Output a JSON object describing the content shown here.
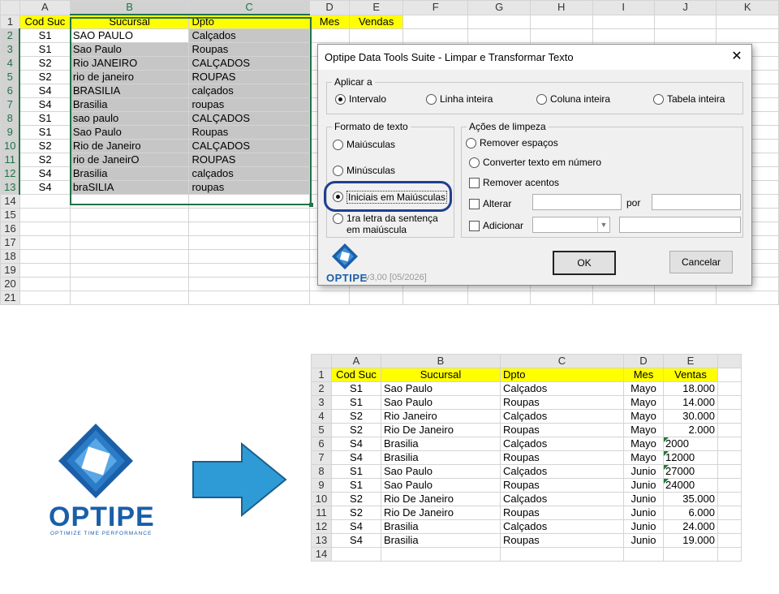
{
  "top_sheet": {
    "col_headers": [
      "A",
      "B",
      "C",
      "D",
      "E",
      "F",
      "G",
      "H",
      "I",
      "J",
      "K"
    ],
    "header_row": [
      "Cod Suc",
      "Sucursal",
      "Dpto",
      "Mes",
      "Vendas"
    ],
    "rows": [
      [
        "S1",
        "SAO PAULO",
        "Calçados"
      ],
      [
        "S1",
        "Sao Paulo",
        "Roupas"
      ],
      [
        "S2",
        "Rio JANEIRO",
        "CALÇADOS"
      ],
      [
        "S2",
        "rio de janeiro",
        "ROUPAS"
      ],
      [
        "S4",
        "BRASILIA",
        "calçados"
      ],
      [
        "S4",
        "Brasilia",
        "roupas"
      ],
      [
        "S1",
        "sao paulo",
        "CALÇADOS"
      ],
      [
        "S1",
        "Sao Paulo",
        "Roupas"
      ],
      [
        "S2",
        "Rio de Janeiro",
        "CALÇADOS"
      ],
      [
        "S2",
        "rio de JaneirO",
        "ROUPAS"
      ],
      [
        "S4",
        "Brasilia",
        "calçados"
      ],
      [
        "S4",
        "braSILIA",
        "roupas"
      ]
    ],
    "row_numbers": [
      "1",
      "2",
      "3",
      "4",
      "5",
      "6",
      "7",
      "8",
      "9",
      "10",
      "11",
      "12",
      "13",
      "14",
      "15",
      "16",
      "17",
      "18",
      "19",
      "20",
      "21"
    ]
  },
  "dialog": {
    "title": "Optipe Data Tools Suite - Limpar e Transformar Texto",
    "close_glyph": "✕",
    "scope_group": "Aplicar a",
    "scope_options": [
      "Intervalo",
      "Linha inteira",
      "Coluna inteira",
      "Tabela inteira"
    ],
    "format_group": "Formato de texto",
    "format_options": [
      "Maiúsculas",
      "Minúsculas",
      "Iniciais em Maiúsculas",
      "1ra letra da sentença em maiúscula"
    ],
    "clean_group": "Ações de limpeza",
    "clean_remove_spaces": "Remover espaços",
    "clean_convert_number": "Converter texto em número",
    "clean_remove_accents": "Remover acentos",
    "clean_replace": "Alterar",
    "clean_by": "por",
    "clean_add": "Adicionar",
    "brand": "OPTIPE",
    "version": "v3,00 [05/2026]",
    "ok_label": "OK",
    "cancel_label": "Cancelar"
  },
  "logo": {
    "brand": "OPTIPE",
    "tagline": "OPTIMIZE TIME PERFORMANCE"
  },
  "bottom_sheet": {
    "col_headers": [
      "A",
      "B",
      "C",
      "D",
      "E"
    ],
    "header_row": [
      "Cod Suc",
      "Sucursal",
      "Dpto",
      "Mes",
      "Ventas"
    ],
    "rows": [
      [
        "S1",
        "Sao Paulo",
        "Calçados",
        "Mayo",
        "18.000"
      ],
      [
        "S1",
        "Sao Paulo",
        "Roupas",
        "Mayo",
        "14.000"
      ],
      [
        "S2",
        "Rio Janeiro",
        "Calçados",
        "Mayo",
        "30.000"
      ],
      [
        "S2",
        "Rio De Janeiro",
        "Roupas",
        "Mayo",
        "2.000"
      ],
      [
        "S4",
        "Brasilia",
        "Calçados",
        "Mayo",
        "2000"
      ],
      [
        "S4",
        "Brasilia",
        "Roupas",
        "Mayo",
        "12000"
      ],
      [
        "S1",
        "Sao Paulo",
        "Calçados",
        "Junio",
        "27000"
      ],
      [
        "S1",
        "Sao Paulo",
        "Roupas",
        "Junio",
        "24000"
      ],
      [
        "S2",
        "Rio De Janeiro",
        "Calçados",
        "Junio",
        "35.000"
      ],
      [
        "S2",
        "Rio De Janeiro",
        "Roupas",
        "Junio",
        "6.000"
      ],
      [
        "S4",
        "Brasilia",
        "Calçados",
        "Junio",
        "24.000"
      ],
      [
        "S4",
        "Brasilia",
        "Roupas",
        "Junio",
        "19.000"
      ]
    ],
    "text_number_rows": [
      4,
      5,
      6,
      7
    ],
    "row_numbers": [
      "1",
      "2",
      "3",
      "4",
      "5",
      "6",
      "7",
      "8",
      "9",
      "10",
      "11",
      "12",
      "13",
      "14"
    ]
  },
  "colors": {
    "header_fill": "#ffff00",
    "selection_fill": "#c6c6c6",
    "selection_border": "#217346",
    "highlight_ring": "#1f3f8f",
    "arrow_fill": "#2e9bd6",
    "brand_blue": "#1a5fa8"
  }
}
